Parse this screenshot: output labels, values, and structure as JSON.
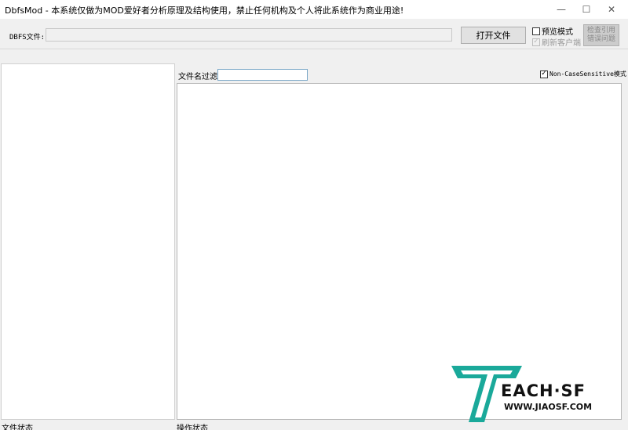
{
  "window": {
    "title": "DbfsMod - 本系统仅做为MOD爱好者分析原理及结构使用，禁止任何机构及个人将此系统作为商业用途!",
    "min_glyph": "—",
    "max_glyph": "☐",
    "close_glyph": "✕"
  },
  "toolbar": {
    "dbfs_label": "DBFS文件:",
    "dbfs_value": "",
    "open_button": "打开文件",
    "preview_label": "预览模式",
    "preview_checked": false,
    "refresh_label": "刷新客户端",
    "refresh_checked": true,
    "refresh_check_glyph": "✓",
    "gray_button_line1": "检查引用",
    "gray_button_line2": "错误问题"
  },
  "filter": {
    "label": "文件名过滤:",
    "value": "",
    "noncase_label": "Non-CaseSensitive模式",
    "noncase_checked": true,
    "noncase_check_glyph": "✓"
  },
  "status": {
    "left": "文件状态",
    "right": "操作状态"
  },
  "watermark": {
    "brand": "EACH·SF",
    "url": "WWW.JIAOSF.COM",
    "logo_color": "#1aa99a",
    "logo_icon": "teach-sf-logo"
  }
}
